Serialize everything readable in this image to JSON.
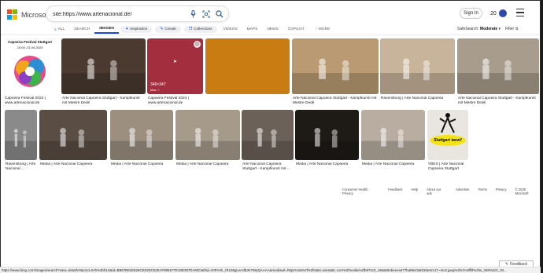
{
  "brand": {
    "name": "Microsoft Bing"
  },
  "search": {
    "query": "site:https://www.artenacional.de/"
  },
  "header": {
    "signin_label": "Sign In",
    "rewards_count": "20"
  },
  "tabs": [
    {
      "label": "ALL",
      "icon": "search-icon"
    },
    {
      "label": "SEARCH"
    },
    {
      "label": "IMAGES",
      "active": true
    },
    {
      "label": "Inspiration",
      "icon": "sparkle-icon"
    },
    {
      "label": "Create",
      "icon": "pen-icon"
    },
    {
      "label": "Collections",
      "icon": "collections-icon"
    },
    {
      "label": "VIDEOS"
    },
    {
      "label": "MAPS"
    },
    {
      "label": "NEWS"
    },
    {
      "label": "COPILOT"
    },
    {
      "label": "⋮ MORE"
    }
  ],
  "filters": {
    "safesearch_label": "SafeSearch:",
    "safesearch_value": "Moderate",
    "filter_label": "Filter"
  },
  "row1": [
    {
      "caption": "Capoeira Festival 2024 | www.artenacional.de",
      "poster_title": "Capoeira Festival Stuttgart",
      "poster_date": "19.04.-21.04.2024",
      "color": "#ffffff"
    },
    {
      "caption": "Arte Nacional Capoeira Stuttgart - Kampfkunst mit Mestre Dedé",
      "color": "#4a3a30"
    },
    {
      "caption": "Capoeira Festival 2024 | www.artenacional.de",
      "color": "#a32e3d",
      "size_text": "348×347",
      "source": "Max",
      "hover": true
    },
    {
      "caption": "",
      "color": "#c97c12"
    },
    {
      "caption": "Arte Nacional Capoeira Stuttgart - Kampfkunst mit Mestre Dedé",
      "color": "#b99a72"
    },
    {
      "caption": "Ravensburg | Arte Nacional Capoeira",
      "color": "#c7b49a"
    },
    {
      "caption": "Arte Nacional Capoeira Stuttgart - Kampfkunst mit Mestre Dedé",
      "color": "#a89d8c"
    }
  ],
  "row2": [
    {
      "caption": "Ravensburg | Arte Nacional ...",
      "color": "#8a8a8a"
    },
    {
      "caption": "Media | Arte Nacional Capoeira",
      "color": "#5a4e44"
    },
    {
      "caption": "Media | Arte Nacional Capoeira",
      "color": "#9c8f80"
    },
    {
      "caption": "Media | Arte Nacional Capoeira",
      "color": "#a69a8a"
    },
    {
      "caption": "Arte Nacional Capoeira Stuttgart - Kampfkunst mit ...",
      "color": "#6b6158"
    },
    {
      "caption": "Media | Arte Nacional Capoeira",
      "color": "#1e1a16"
    },
    {
      "caption": "Media | Arte Nacional Capoeira",
      "color": "#b8ada0"
    },
    {
      "caption": "VBKS | Arte Nacional Capoeira Stuttgart",
      "color": "#e9e6e0",
      "poster_text": "Stuttgart tanzt!"
    }
  ],
  "footer": [
    "Consumer Health Privacy",
    "Feedback",
    "Help",
    "About our ads",
    "Advertise",
    "Terms",
    "Privacy",
    "© 2025 Microsoft"
  ],
  "statusbar": {
    "url": "https://www.bing.com/images/search?view=detailV2&ccid=tHh%2bh1S&id=BB67B81E826CED25C52EAF8851F7E19D387DA83C&thid=OIP.tHh_zh1S8gLecsf8JK7WpQAAAA&mediaurl=https%3a%2f%2fstatic.wixstatic.com%2fmedia%2fb872c0_c66a50ebeeea477ba96c0a923de6cc17~mv2.jpeg%2fv1%2ffill%2fw_348%2ch_34..."
  },
  "feedback_label": "Feedback",
  "colors": {
    "accent": "#174ae4",
    "status_bg": "#f1f1f1"
  }
}
